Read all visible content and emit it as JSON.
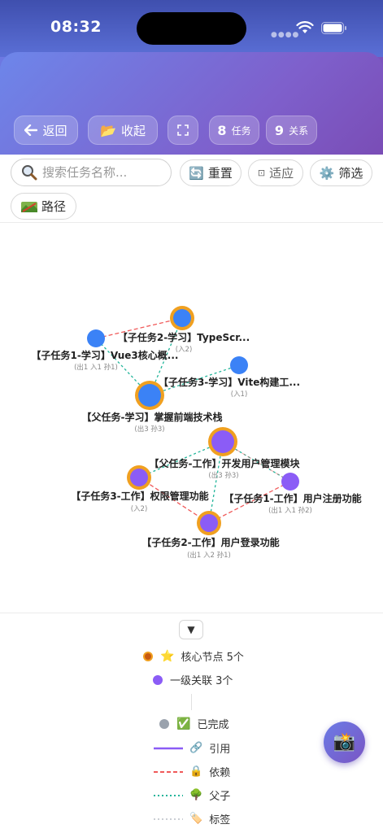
{
  "status": {
    "time": "08:32"
  },
  "header": {
    "back_label": "返回",
    "collapse_label": "收起",
    "task_count": "8",
    "task_unit": "任务",
    "relation_count": "9",
    "relation_unit": "关系"
  },
  "toolbar": {
    "search_placeholder": "搜索任务名称...",
    "reset_label": "重置",
    "fit_label": "适应",
    "filter_label": "筛选",
    "path_label": "路径"
  },
  "graph": {
    "nodes": [
      {
        "label": "【子任务2-学习】TypeScr...",
        "sub": "(入2)"
      },
      {
        "label": "【子任务1-学习】Vue3核心概...",
        "sub": "(出1 入1 孙1)"
      },
      {
        "label": "【子任务3-学习】Vite构建工...",
        "sub": "(入1)"
      },
      {
        "label": "【父任务-学习】掌握前端技术栈",
        "sub": "(出3 孙3)"
      },
      {
        "label": "【父任务-工作】开发用户管理模块",
        "sub": "(出3 孙3)"
      },
      {
        "label": "【子任务3-工作】权限管理功能",
        "sub": "(入2)"
      },
      {
        "label": "【子任务1-工作】用户注册功能",
        "sub": "(出1 入1 孙2)"
      },
      {
        "label": "【子任务2-工作】用户登录功能",
        "sub": "(出1 入2 孙1)"
      }
    ],
    "colors": {
      "blue": "#3b82f6",
      "purple": "#8b5cf6",
      "orange_ring": "#f0a020",
      "dependency": "#f05a5a",
      "parent_child": "#22b59a"
    }
  },
  "legend": {
    "core_node": "核心节点 5个",
    "first_level": "一级关联 3个",
    "completed": "已完成",
    "reference": "引用",
    "dependency": "依赖",
    "parent_child": "父子",
    "tag": "标签"
  },
  "icons": [
    "arrow-left-icon",
    "folder-icon",
    "expand-icon",
    "search-icon",
    "reset-icon",
    "fit-icon",
    "gear-icon",
    "path-icon",
    "star-icon",
    "check-icon",
    "link-icon",
    "lock-icon",
    "tree-icon",
    "tag-icon",
    "camera-icon",
    "chevron-down-icon"
  ]
}
